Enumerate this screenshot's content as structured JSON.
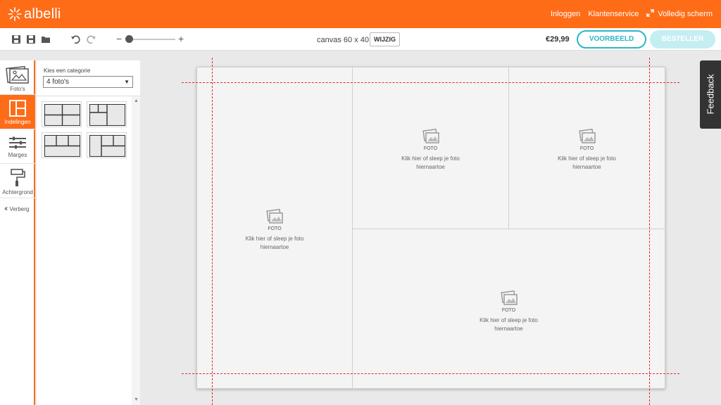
{
  "brand": {
    "name": "albelli",
    "color": "#ff6c17"
  },
  "header": {
    "links": [
      "Inloggen",
      "Klantenservice",
      "Volledig scherm"
    ]
  },
  "toolbar": {
    "canvas_size": "canvas 60 x 40",
    "change_label": "WIJZIG",
    "price": "€29,99",
    "preview_label": "VOORBEELD",
    "order_label": "BESTELLEN",
    "zoom": 0
  },
  "rail": {
    "items": [
      {
        "label": "Foto's",
        "icon": "photos-icon"
      },
      {
        "label": "Indelingen",
        "icon": "layouts-icon"
      },
      {
        "label": "Marges",
        "icon": "margins-icon"
      },
      {
        "label": "Achtergrond",
        "icon": "background-roller-icon"
      }
    ],
    "hide_label": "Verberg",
    "accent": "#ff6c17"
  },
  "panel": {
    "category_label": "Kies een categorie",
    "category_value": "4 foto's"
  },
  "canvas": {
    "slots": [
      {
        "foto": "FOTO",
        "text_line1": "Klik hier of sleep je foto",
        "text_line2": "hiernaartoe"
      },
      {
        "foto": "FOTO",
        "text_line1": "Klik hier of sleep je foto",
        "text_line2": "hiernaartoe"
      },
      {
        "foto": "FOTO",
        "text_line1": "Klik hier of sleep je foto",
        "text_line2": "hiernaartoe"
      },
      {
        "foto": "FOTO",
        "text_line1": "Klik hier of sleep je foto",
        "text_line2": "hiernaartoe"
      }
    ]
  },
  "feedback": {
    "label": "Feedback"
  },
  "colors": {
    "accent_teal": "#2bb6c4",
    "guide_red": "#e2272d"
  }
}
